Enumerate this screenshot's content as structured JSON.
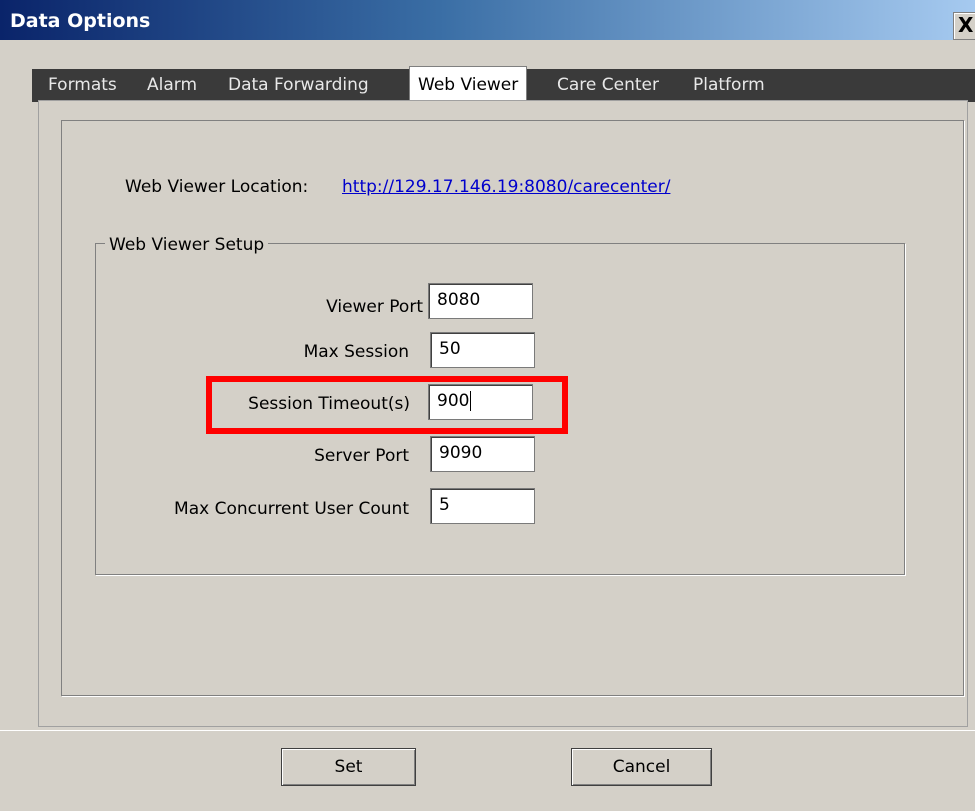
{
  "window": {
    "title": "Data Options",
    "close_glyph": "X"
  },
  "tabs": [
    {
      "label": "Formats",
      "active": false
    },
    {
      "label": "Alarm",
      "active": false
    },
    {
      "label": "Data Forwarding",
      "active": false
    },
    {
      "label": "Web Viewer",
      "active": true
    },
    {
      "label": "Care Center",
      "active": false
    },
    {
      "label": "Platform",
      "active": false
    }
  ],
  "web_viewer": {
    "location_label": "Web Viewer Location:",
    "location_url": "http://129.17.146.19:8080/carecenter/",
    "setup_title": "Web Viewer Setup",
    "fields": [
      {
        "label": "Viewer Port",
        "value": "8080"
      },
      {
        "label": "Max Session",
        "value": "50"
      },
      {
        "label": "Session Timeout(s)",
        "value": "900"
      },
      {
        "label": "Server Port",
        "value": "9090"
      },
      {
        "label": "Max Concurrent User Count",
        "value": "5"
      }
    ]
  },
  "buttons": {
    "set": "Set",
    "cancel": "Cancel"
  },
  "colors": {
    "highlight": "#ff0000",
    "link": "#0000cc",
    "title_bar_start": "#0a246a",
    "title_bar_end": "#a6caf0"
  },
  "icons": [
    "close-icon"
  ]
}
